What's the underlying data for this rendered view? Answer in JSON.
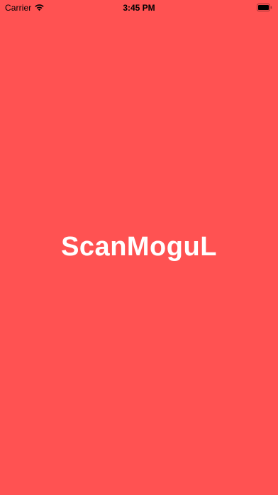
{
  "status_bar": {
    "carrier": "Carrier",
    "time": "3:45 PM",
    "wifi_icon": "wifi-icon",
    "battery_icon": "battery-icon"
  },
  "splash": {
    "app_name": "ScanMoguL",
    "background_color": "#ff5252",
    "text_color": "#ffffff"
  }
}
